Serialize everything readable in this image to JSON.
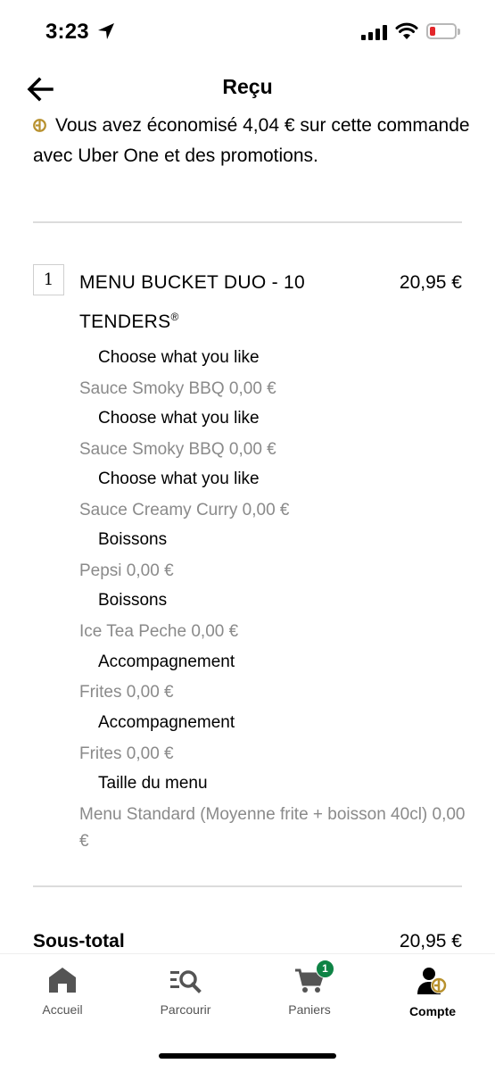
{
  "status_bar": {
    "time": "3:23"
  },
  "header": {
    "title": "Reçu"
  },
  "savings_message": "Vous avez économisé 4,04 € sur cette commande avec Uber One et des promotions.",
  "order_item": {
    "quantity": "1",
    "name": "MENU BUCKET DUO - 10 TENDERS",
    "trademark": "®",
    "price": "20,95 €",
    "options": [
      {
        "group": "Choose what you like",
        "value": "Sauce Smoky BBQ 0,00 €"
      },
      {
        "group": "Choose what you like",
        "value": "Sauce Smoky BBQ 0,00 €"
      },
      {
        "group": "Choose what you like",
        "value": "Sauce Creamy Curry 0,00 €"
      },
      {
        "group": "Boissons",
        "value": "Pepsi 0,00 €"
      },
      {
        "group": "Boissons",
        "value": "Ice Tea Peche 0,00 €"
      },
      {
        "group": "Accompagnement",
        "value": "Frites 0,00 €"
      },
      {
        "group": "Accompagnement",
        "value": "Frites 0,00 €"
      },
      {
        "group": "Taille du menu",
        "value": "Menu Standard (Moyenne frite + boisson 40cl) 0,00 €"
      }
    ]
  },
  "subtotal": {
    "label": "Sous-total",
    "value": "20,95 €"
  },
  "tab_bar": {
    "tabs": [
      {
        "label": "Accueil",
        "icon": "home-icon"
      },
      {
        "label": "Parcourir",
        "icon": "browse-icon"
      },
      {
        "label": "Paniers",
        "icon": "cart-icon",
        "badge": "1"
      },
      {
        "label": "Compte",
        "icon": "account-icon",
        "active": true
      }
    ]
  },
  "colors": {
    "uber_one_gold": "#b8912e",
    "badge_green": "#0e8345",
    "secondary_text": "#8a8a8a",
    "battery_low": "#e3262a"
  }
}
